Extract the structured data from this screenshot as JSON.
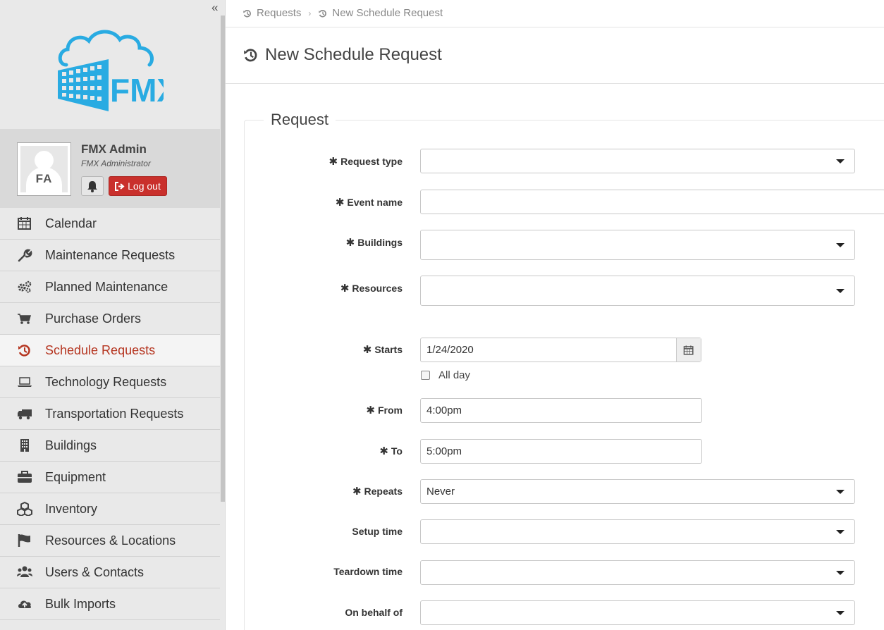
{
  "sidebar": {
    "collapse_label": "«",
    "logo_text": "FMX",
    "profile": {
      "initials": "FA",
      "name": "FMX Admin",
      "role": "FMX Administrator",
      "logout_label": "Log out"
    },
    "items": [
      {
        "label": "Calendar",
        "icon": "calendar-icon"
      },
      {
        "label": "Maintenance Requests",
        "icon": "wrench-icon"
      },
      {
        "label": "Planned Maintenance",
        "icon": "gears-icon"
      },
      {
        "label": "Purchase Orders",
        "icon": "cart-icon"
      },
      {
        "label": "Schedule Requests",
        "icon": "history-icon",
        "active": true
      },
      {
        "label": "Technology Requests",
        "icon": "laptop-icon"
      },
      {
        "label": "Transportation Requests",
        "icon": "truck-icon"
      },
      {
        "label": "Buildings",
        "icon": "building-icon"
      },
      {
        "label": "Equipment",
        "icon": "briefcase-icon"
      },
      {
        "label": "Inventory",
        "icon": "cubes-icon"
      },
      {
        "label": "Resources & Locations",
        "icon": "flag-icon"
      },
      {
        "label": "Users & Contacts",
        "icon": "users-icon"
      },
      {
        "label": "Bulk Imports",
        "icon": "cloud-upload-icon"
      }
    ]
  },
  "breadcrumb": {
    "items": [
      "Requests",
      "New Schedule Request"
    ]
  },
  "page": {
    "title": "New Schedule Request",
    "section": "Request"
  },
  "form": {
    "request_type": {
      "label": "Request type",
      "value": ""
    },
    "event_name": {
      "label": "Event name",
      "value": ""
    },
    "buildings": {
      "label": "Buildings",
      "value": ""
    },
    "resources": {
      "label": "Resources",
      "value": ""
    },
    "starts": {
      "label": "Starts",
      "value": "1/24/2020"
    },
    "all_day": {
      "label": "All day",
      "checked": false
    },
    "from": {
      "label": "From",
      "value": "4:00pm"
    },
    "to": {
      "label": "To",
      "value": "5:00pm"
    },
    "repeats": {
      "label": "Repeats",
      "value": "Never"
    },
    "setup_time": {
      "label": "Setup time",
      "value": ""
    },
    "teardown_time": {
      "label": "Teardown time",
      "value": ""
    },
    "on_behalf_of": {
      "label": "On behalf of",
      "value": ""
    }
  },
  "colors": {
    "accent": "#b53520",
    "logo_blue": "#29abe2",
    "logout_red": "#c9302c"
  }
}
